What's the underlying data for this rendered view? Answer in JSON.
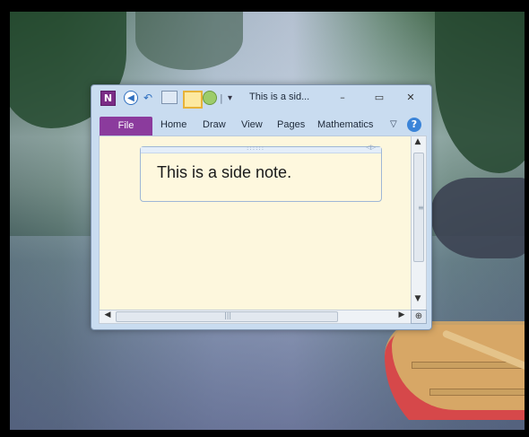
{
  "window": {
    "title": "This is a sid...",
    "app_icon_letter": "N",
    "controls": {
      "minimize": "–",
      "maximize": "▭",
      "close": "✕"
    }
  },
  "quick_access": {
    "back_glyph": "◀",
    "undo_glyph": "↶",
    "separator": "|",
    "more_glyph": "▾"
  },
  "ribbon": {
    "file": "File",
    "tabs": [
      "Home",
      "Draw",
      "View",
      "Pages",
      "Mathematics"
    ],
    "expand_glyph": "▽",
    "help": "?"
  },
  "note": {
    "text": "This is a side note.",
    "grip": "::::::",
    "resize": "◁▷"
  },
  "scrollbars": {
    "up": "▲",
    "down": "▼",
    "left": "◀",
    "right": "▶",
    "vgrip": "≡",
    "hgrip": "|||",
    "newpage_glyph": "⊕"
  }
}
